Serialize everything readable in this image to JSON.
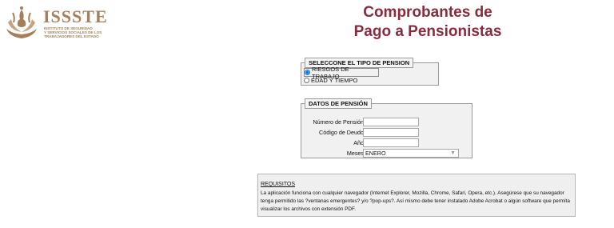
{
  "logo": {
    "title": "ISSSTE",
    "subtitle_lines": [
      "INSTITUTO DE SEGURIDAD",
      "Y SERVICIOS SOCIALES DE LOS",
      "TRABAJADORES DEL ESTADO"
    ]
  },
  "header": {
    "title_line1": "Comprobantes de",
    "title_line2": "Pago a Pensionistas"
  },
  "tipo_pension": {
    "legend": "SELECCONE EL TIPO DE PENSION",
    "options": [
      {
        "label": "RIESGOS DE TRABAJO",
        "selected": true
      },
      {
        "label": "EDAD Y TIEMPO",
        "selected": false
      }
    ]
  },
  "datos_pension": {
    "legend": "DATOS DE PENSIÓN",
    "fields": [
      {
        "label": "Número de Pensión",
        "value": ""
      },
      {
        "label": "Código de Deudo",
        "value": ""
      },
      {
        "label": "Año",
        "value": ""
      }
    ],
    "meses": {
      "label": "Meses",
      "selected": "ENERO"
    }
  },
  "requisitos": {
    "title": "REQUISITOS",
    "text": "La aplicación funciona con cualquier navegador (Internet Explorer, Mozilla, Chrome, Safari, Opera, etc.). Asegúrese que su navegador tenga permitido las ?ventanas emergentes? y/o ?pop-ups?. Así mismo debe tener instalado Adobe Acrobat o algún software que permita visualizar los archivos con extensión PDF."
  },
  "colors": {
    "brand_gold": "#a57f5a",
    "title_maroon": "#8a2b3d",
    "panel_bg": "#f1f1f1"
  }
}
